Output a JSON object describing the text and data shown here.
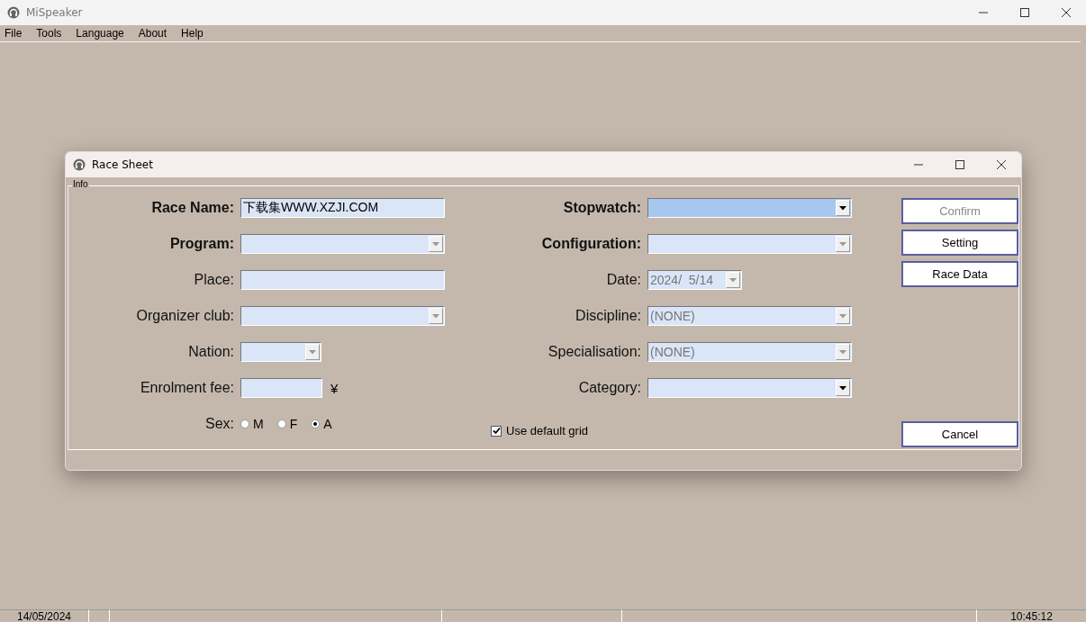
{
  "window": {
    "title": "MiSpeaker"
  },
  "menu": [
    "File",
    "Tools",
    "Language",
    "About",
    "Help"
  ],
  "dialog": {
    "title": "Race Sheet",
    "group_label": "Info",
    "left_fields": [
      {
        "label": "Race Name:",
        "bold": true,
        "kind": "text",
        "value": "下载集WWW.XZJI.COM"
      },
      {
        "label": "Program:",
        "bold": true,
        "kind": "combo",
        "disabled": true
      },
      {
        "label": "Place:",
        "bold": false,
        "kind": "text"
      },
      {
        "label": "Organizer club:",
        "bold": false,
        "kind": "combo",
        "disabled": true
      },
      {
        "label": "Nation:",
        "bold": false,
        "kind": "combo",
        "disabled": true
      },
      {
        "label": "Enrolment fee:",
        "bold": false,
        "kind": "text",
        "suffix": "¥"
      }
    ],
    "sex": {
      "label": "Sex:",
      "options": [
        {
          "label": "M",
          "selected": false
        },
        {
          "label": "F",
          "selected": false
        },
        {
          "label": "A",
          "selected": true
        }
      ]
    },
    "right_fields": [
      {
        "label": "Stopwatch:",
        "bold": true,
        "kind": "combo",
        "disabled": false,
        "focused": true
      },
      {
        "label": "Configuration:",
        "bold": true,
        "kind": "combo",
        "disabled": true,
        "focused": false
      },
      {
        "label": "Date:",
        "bold": false,
        "kind": "combo",
        "value": "2024/  5/14",
        "disabled": true,
        "focused": false
      },
      {
        "label": "Discipline:",
        "bold": false,
        "kind": "combo",
        "value": "(NONE)",
        "disabled": true,
        "focused": false
      },
      {
        "label": "Specialisation:",
        "bold": false,
        "kind": "combo",
        "value": "(NONE)",
        "disabled": true,
        "focused": false
      },
      {
        "label": "Category:",
        "bold": false,
        "kind": "combo",
        "disabled": false,
        "focused": false
      }
    ],
    "checkbox": {
      "label": "Use default grid",
      "checked": true
    },
    "buttons": [
      {
        "label": "Confirm",
        "disabled": true
      },
      {
        "label": "Setting",
        "disabled": false
      },
      {
        "label": "Race Data",
        "disabled": false
      }
    ],
    "cancel_button": {
      "label": "Cancel",
      "disabled": false
    }
  },
  "status_bar": {
    "date": "14/05/2024",
    "time": "10:45:12"
  }
}
